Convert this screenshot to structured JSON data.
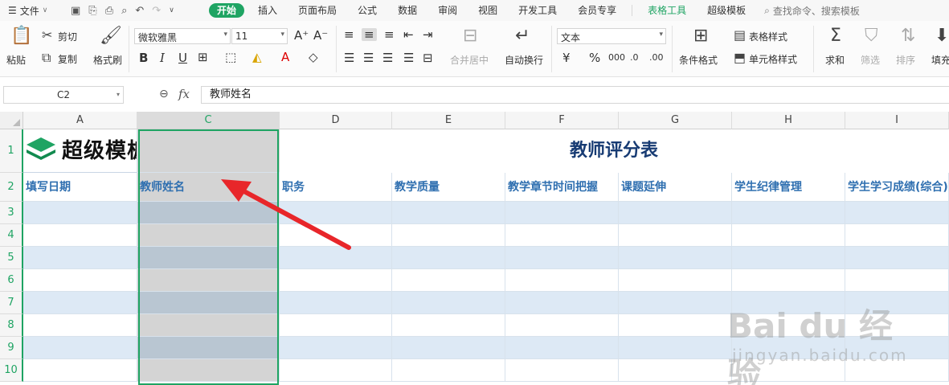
{
  "menubar": {
    "file_label": "文件",
    "tabs": [
      "开始",
      "插入",
      "页面布局",
      "公式",
      "数据",
      "审阅",
      "视图",
      "开发工具",
      "会员专享"
    ],
    "active_tab": "开始",
    "context_tabs": [
      "表格工具",
      "超级模板"
    ],
    "search_label": "查找命令、搜索模板"
  },
  "ribbon": {
    "paste": "粘贴",
    "cut": "剪切",
    "copy": "复制",
    "format_painter": "格式刷",
    "font_name": "微软雅黑",
    "font_size": "11",
    "merge_center": "合并居中",
    "wrap_text": "自动换行",
    "number_format": "文本",
    "table_style": "表格样式",
    "conditional_format": "条件格式",
    "cell_style": "单元格样式",
    "sum": "求和",
    "filter": "筛选",
    "sort": "排序",
    "fill": "填充"
  },
  "formula_bar": {
    "name_box": "C2",
    "fx": "fx",
    "content": "教师姓名"
  },
  "sheet": {
    "columns": [
      "A",
      "C",
      "D",
      "E",
      "F",
      "G",
      "H",
      "I"
    ],
    "selected_column": "C",
    "rows": [
      "1",
      "2",
      "3",
      "4",
      "5",
      "6",
      "7",
      "8",
      "9",
      "10"
    ],
    "logo_text": "超级模板",
    "title": "教师评分表",
    "headers": [
      "填写日期",
      "教师姓名",
      "职务",
      "教学质量",
      "教学章节时间把握",
      "课题延伸",
      "学生纪律管理",
      "学生学习成绩(综合)"
    ]
  },
  "watermark": {
    "main": "Bai du 经验",
    "sub": "jingyan.baidu.com"
  },
  "colors": {
    "accent": "#1fa463",
    "header_text": "#2f6fb0",
    "title_text": "#173b73",
    "band": "#dde9f5",
    "selection_fill": "#d4d4d4",
    "arrow": "#e8262a"
  }
}
